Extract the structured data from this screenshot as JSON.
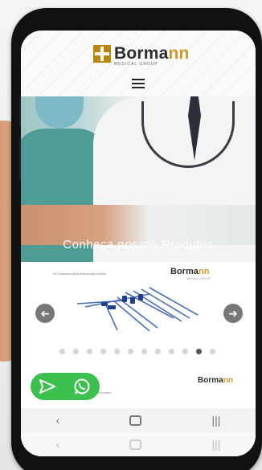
{
  "header": {
    "logo_main": "Borma",
    "logo_highlight": "nn",
    "logo_sub": "MEDICAL GROUP"
  },
  "hero": {
    "title": "Conheça nossos Produtos"
  },
  "slider": {
    "caption": "Kit Canulado para Artroscopia Anchor",
    "brand_main": "Borma",
    "brand_highlight": "nn",
    "brand_sub": "MEDICAL GROUP",
    "dot_count": 12,
    "active_dot": 10,
    "prev_icon": "arrow-left-icon",
    "next_icon": "arrow-right-icon"
  },
  "lower": {
    "brand_main": "Borma",
    "brand_highlight": "nn",
    "text": "Cannulated"
  },
  "whatsapp": {
    "icons": [
      "send-icon",
      "whatsapp-icon"
    ]
  },
  "navbar": {
    "back": "‹",
    "recents": "|||"
  },
  "colors": {
    "brand_gold": "#c89b2c",
    "whatsapp_green": "#3cc04e",
    "arrow_gray": "#777777"
  }
}
